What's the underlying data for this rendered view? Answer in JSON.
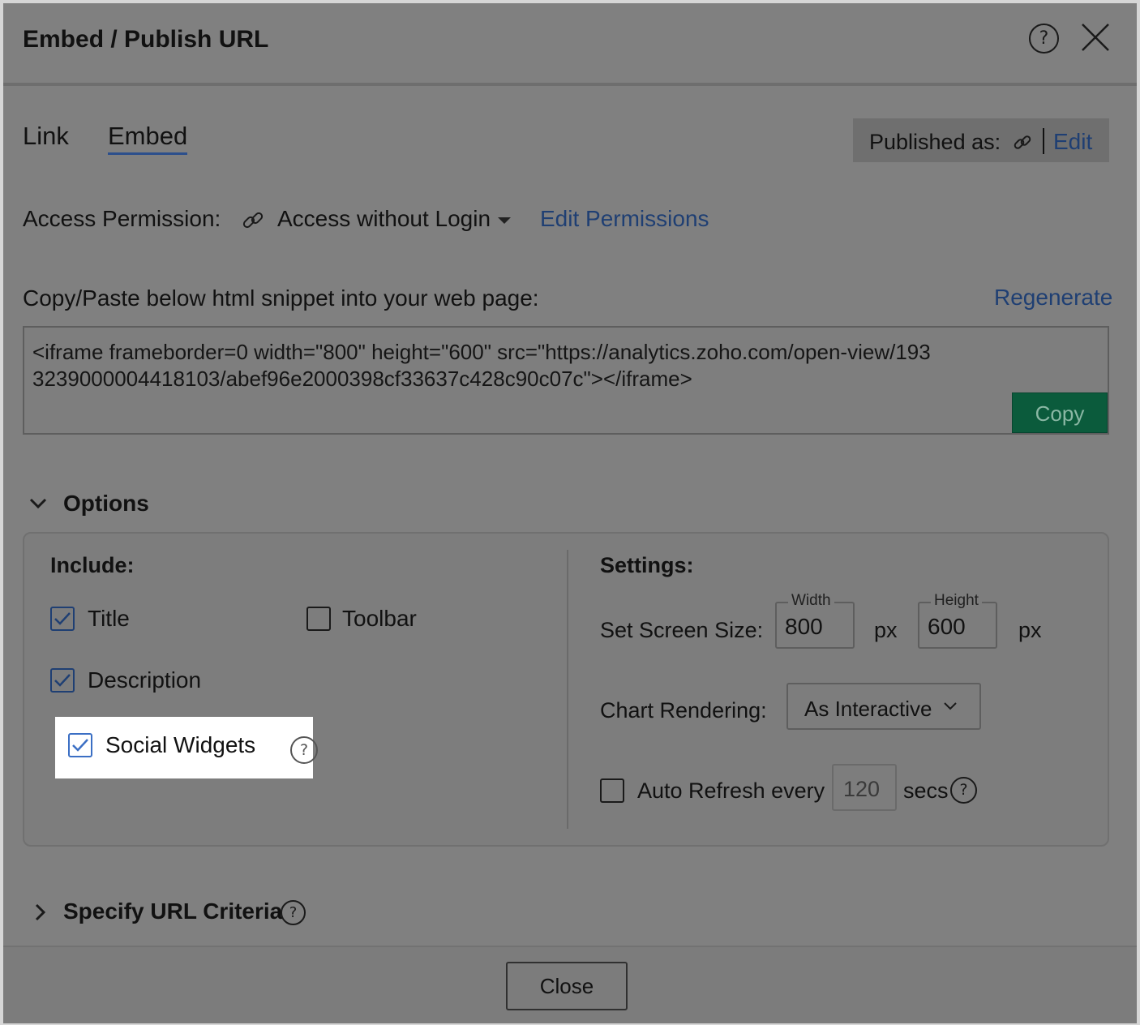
{
  "dialog": {
    "title": "Embed / Publish URL",
    "help_icon": "help-icon",
    "close_icon": "close-icon"
  },
  "tabs": [
    {
      "label": "Link",
      "active": false
    },
    {
      "label": "Embed",
      "active": true
    }
  ],
  "published": {
    "label": "Published as:",
    "icon": "link-icon",
    "edit_label": "Edit"
  },
  "access": {
    "label": "Access Permission:",
    "icon": "link-icon",
    "value": "Access without Login",
    "edit_permissions_label": "Edit Permissions"
  },
  "snippet": {
    "label": "Copy/Paste below html snippet into your web page:",
    "regenerate_label": "Regenerate",
    "code": "<iframe frameborder=0 width=\"800\" height=\"600\" src=\"https://analytics.zoho.com/open-view/1933239000004418103/abef96e2000398cf33637c428c90c07c\"></iframe>",
    "copy_label": "Copy"
  },
  "options": {
    "label": "Options",
    "expanded": true,
    "include": {
      "heading": "Include:",
      "items": [
        {
          "label": "Title",
          "checked": true
        },
        {
          "label": "Toolbar",
          "checked": false
        },
        {
          "label": "Description",
          "checked": true
        },
        {
          "label": "Social Widgets",
          "checked": true
        }
      ]
    },
    "settings": {
      "heading": "Settings:",
      "screen_size_label": "Set Screen Size:",
      "width_label": "Width",
      "width_value": "800",
      "height_label": "Height",
      "height_value": "600",
      "unit": "px",
      "chart_rendering_label": "Chart Rendering:",
      "chart_rendering_value": "As Interactive",
      "auto_refresh_label": "Auto Refresh every",
      "auto_refresh_checked": false,
      "auto_refresh_value": "120",
      "auto_refresh_unit": "secs"
    }
  },
  "url_criteria": {
    "label": "Specify URL Criteria",
    "expanded": false
  },
  "footer": {
    "close_label": "Close"
  },
  "colors": {
    "overlay_gray": "#808080",
    "link_blue": "#1f3f73",
    "copy_green": "#0b5b3c",
    "highlight": "#ffffff"
  }
}
